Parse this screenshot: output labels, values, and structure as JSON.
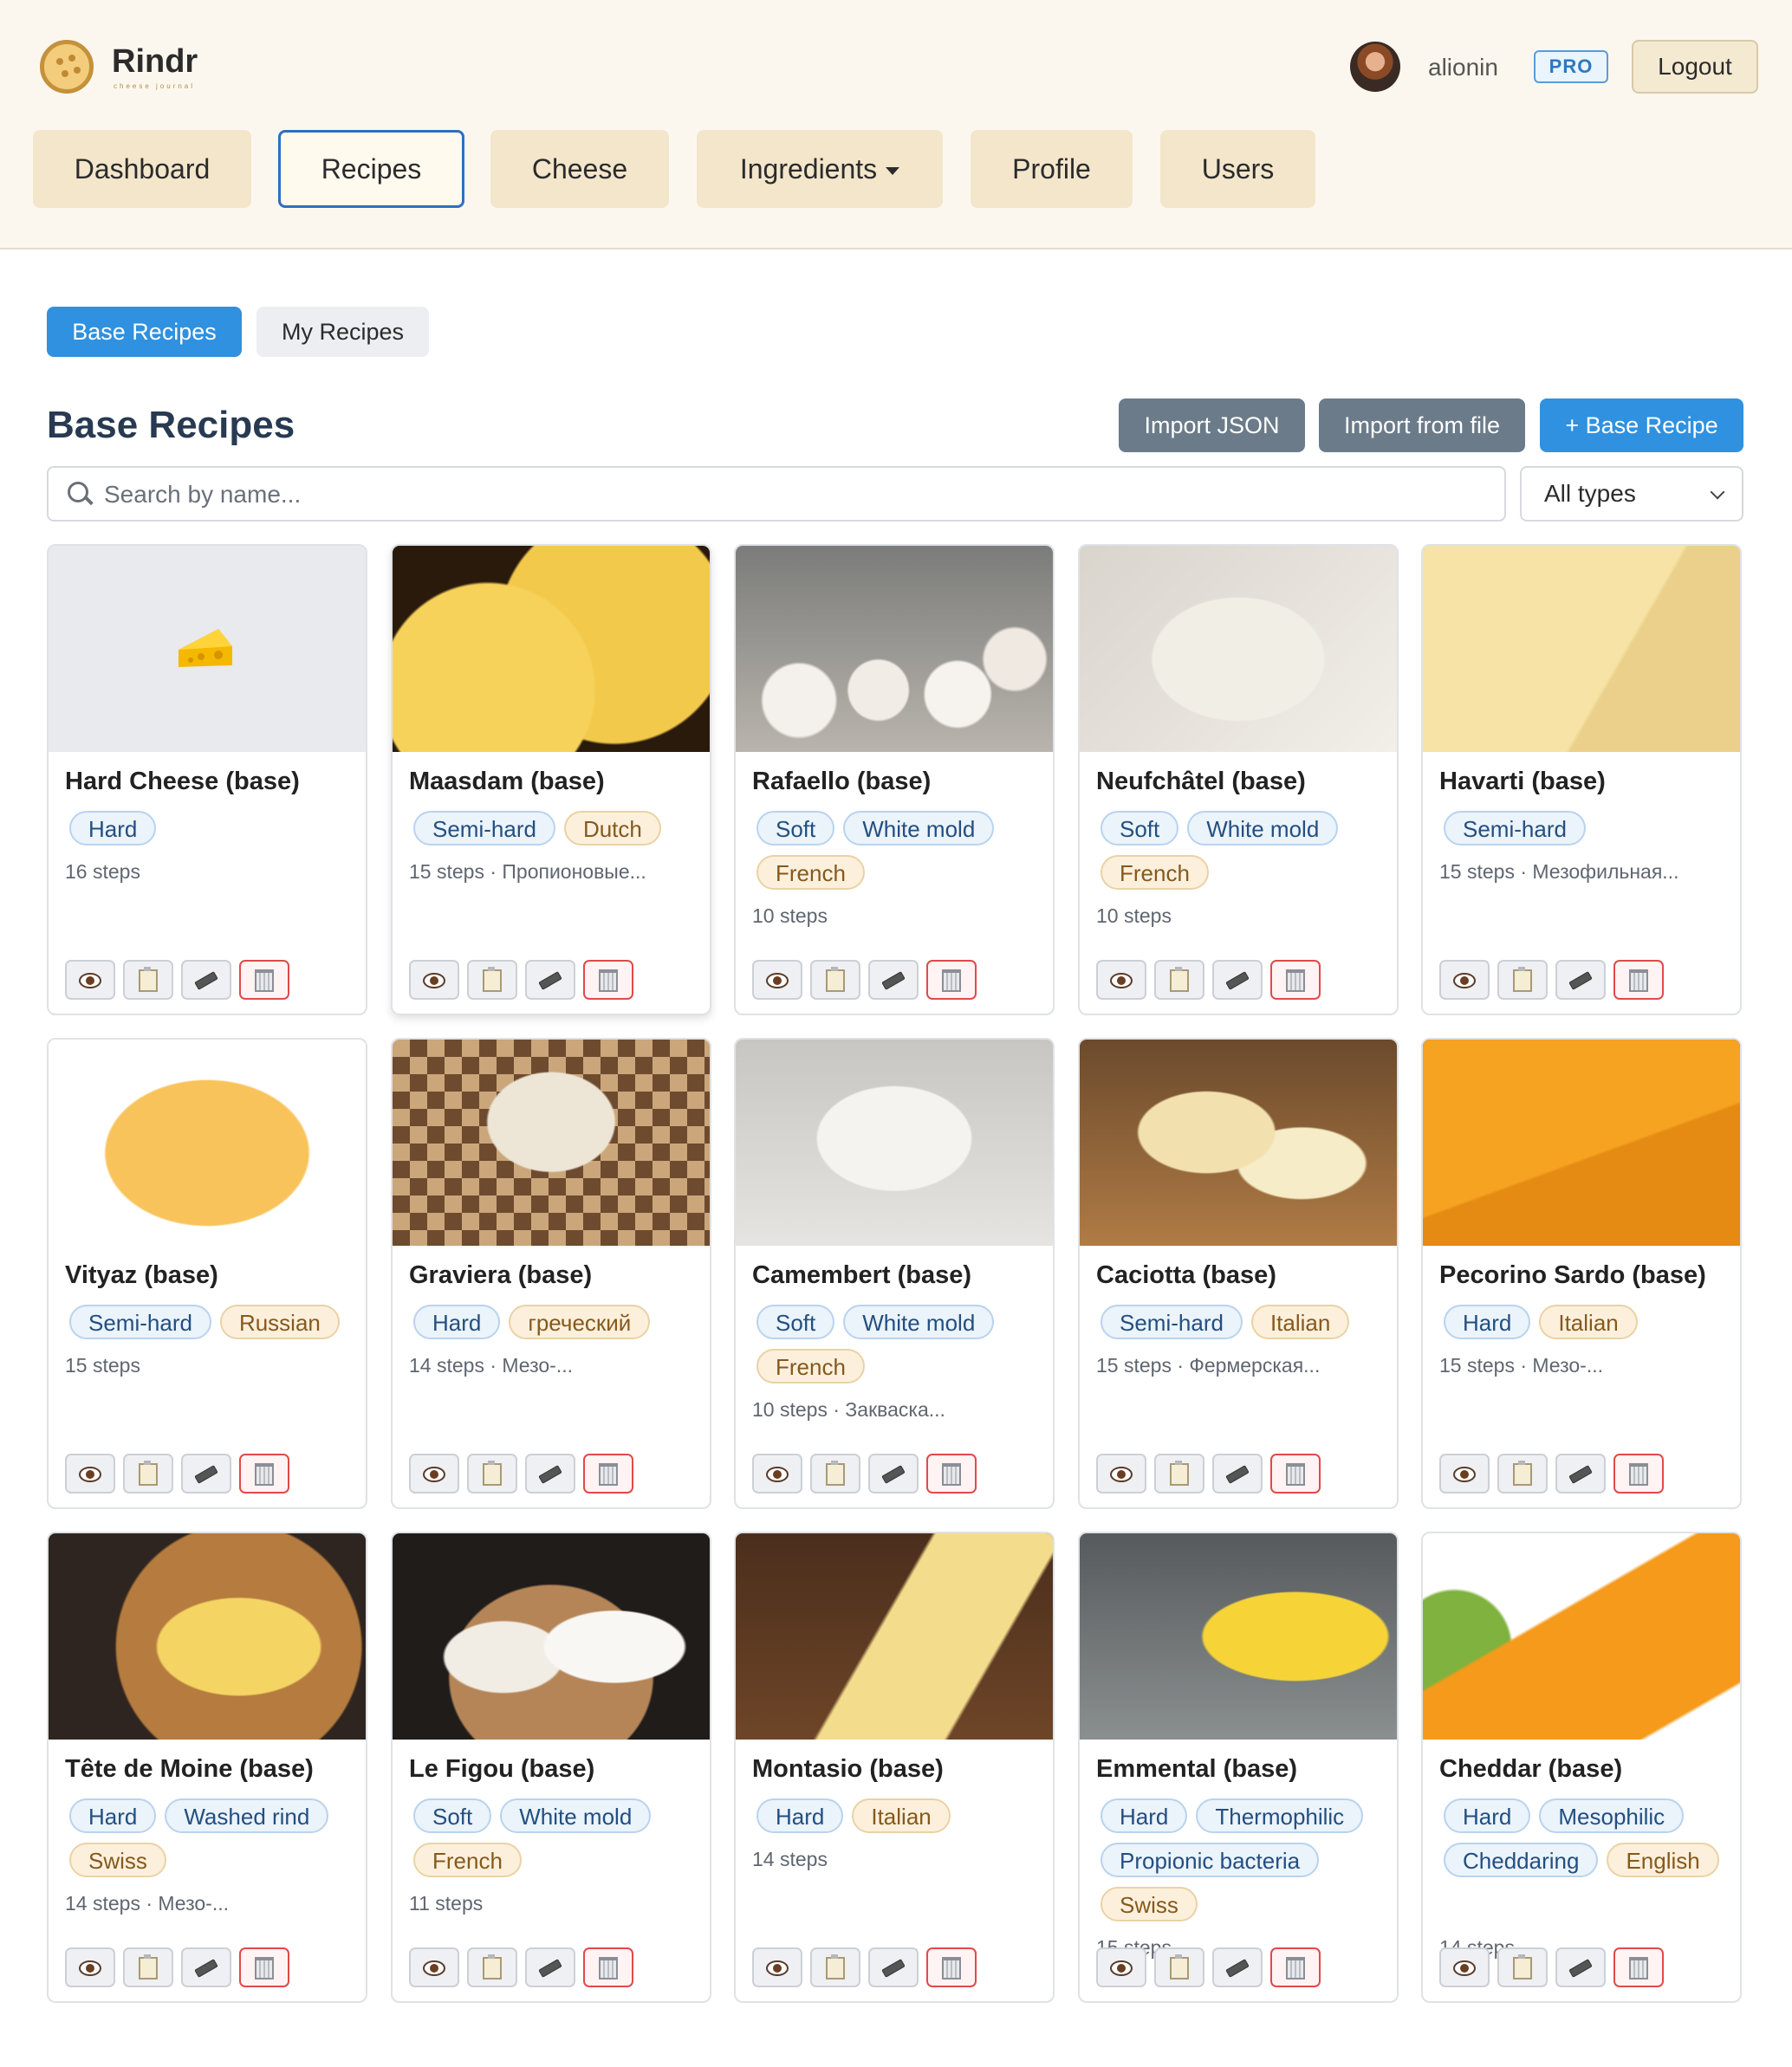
{
  "app": {
    "name": "Rindr",
    "tagline": "cheese journal"
  },
  "user": {
    "name": "alionin",
    "badge": "PRO",
    "logout_label": "Logout"
  },
  "nav": [
    {
      "label": "Dashboard"
    },
    {
      "label": "Recipes",
      "active": true
    },
    {
      "label": "Cheese"
    },
    {
      "label": "Ingredients",
      "dropdown": true
    },
    {
      "label": "Profile"
    },
    {
      "label": "Users"
    }
  ],
  "tabs": [
    {
      "label": "Base Recipes",
      "active": true
    },
    {
      "label": "My Recipes"
    }
  ],
  "page": {
    "title": "Base Recipes",
    "import_json_label": "Import JSON",
    "import_file_label": "Import from file",
    "add_label": "+ Base Recipe",
    "search_placeholder": "Search by name...",
    "type_filter": "All types"
  },
  "colors": {
    "accent_blue": "#2f91df",
    "nav_bg": "#f3e6cb",
    "header_bg": "#fcf7ee",
    "delete_red": "#e04a4a"
  },
  "recipes": [
    {
      "title": "Hard Cheese (base)",
      "tags": [
        [
          "Hard",
          "blue"
        ]
      ],
      "meta": "16 steps",
      "image": "cheese-emoji-placeholder"
    },
    {
      "title": "Maasdam (base)",
      "tags": [
        [
          "Semi-hard",
          "blue"
        ],
        [
          "Dutch",
          "tan"
        ]
      ],
      "meta": "15 steps · Пропионовые...",
      "image": "maasdam-photo"
    },
    {
      "title": "Rafaello (base)",
      "tags": [
        [
          "Soft",
          "blue"
        ],
        [
          "White mold",
          "blue"
        ],
        [
          "French",
          "tan"
        ]
      ],
      "meta": "10 steps",
      "image": "rafaello-photo"
    },
    {
      "title": "Neufchâtel (base)",
      "tags": [
        [
          "Soft",
          "blue"
        ],
        [
          "White mold",
          "blue"
        ],
        [
          "French",
          "tan"
        ]
      ],
      "meta": "10 steps",
      "image": "neufchatel-photo"
    },
    {
      "title": "Havarti (base)",
      "tags": [
        [
          "Semi-hard",
          "blue"
        ]
      ],
      "meta": "15 steps · Мезофильная...",
      "image": "havarti-photo"
    },
    {
      "title": "Vityaz (base)",
      "tags": [
        [
          "Semi-hard",
          "blue"
        ],
        [
          "Russian",
          "tan"
        ]
      ],
      "meta": "15 steps",
      "image": "vityaz-photo"
    },
    {
      "title": "Graviera (base)",
      "tags": [
        [
          "Hard",
          "blue"
        ],
        [
          "греческий",
          "tan"
        ]
      ],
      "meta": "14 steps · Мезо-...",
      "image": "graviera-photo"
    },
    {
      "title": "Camembert (base)",
      "tags": [
        [
          "Soft",
          "blue"
        ],
        [
          "White mold",
          "blue"
        ],
        [
          "French",
          "tan"
        ]
      ],
      "meta": "10 steps · Закваска...",
      "image": "camembert-photo"
    },
    {
      "title": "Caciotta (base)",
      "tags": [
        [
          "Semi-hard",
          "blue"
        ],
        [
          "Italian",
          "tan"
        ]
      ],
      "meta": "15 steps · Фермерская...",
      "image": "caciotta-photo"
    },
    {
      "title": "Pecorino Sardo (base)",
      "tags": [
        [
          "Hard",
          "blue"
        ],
        [
          "Italian",
          "tan"
        ]
      ],
      "meta": "15 steps · Мезо-...",
      "image": "pecorino-photo"
    },
    {
      "title": "Tête de Moine (base)",
      "tags": [
        [
          "Hard",
          "blue"
        ],
        [
          "Washed rind",
          "blue"
        ],
        [
          "Swiss",
          "tan"
        ]
      ],
      "meta": "14 steps · Мезо-...",
      "image": "tete-de-moine-photo"
    },
    {
      "title": "Le Figou (base)",
      "tags": [
        [
          "Soft",
          "blue"
        ],
        [
          "White mold",
          "blue"
        ],
        [
          "French",
          "tan"
        ]
      ],
      "meta": "11 steps",
      "image": "le-figou-photo"
    },
    {
      "title": "Montasio (base)",
      "tags": [
        [
          "Hard",
          "blue"
        ],
        [
          "Italian",
          "tan"
        ]
      ],
      "meta": "14 steps",
      "image": "montasio-photo"
    },
    {
      "title": "Emmental (base)",
      "tags": [
        [
          "Hard",
          "blue"
        ],
        [
          "Thermophilic",
          "blue"
        ],
        [
          "Propionic bacteria",
          "blue"
        ],
        [
          "Swiss",
          "tan"
        ]
      ],
      "meta": "15 steps",
      "image": "emmental-photo"
    },
    {
      "title": "Cheddar (base)",
      "tags": [
        [
          "Hard",
          "blue"
        ],
        [
          "Mesophilic",
          "blue"
        ],
        [
          "Cheddaring",
          "blue"
        ],
        [
          "English",
          "tan"
        ]
      ],
      "meta": "14 steps",
      "image": "cheddar-photo"
    }
  ],
  "card_actions": [
    {
      "name": "view-button",
      "icon": "eye-icon"
    },
    {
      "name": "copy-button",
      "icon": "clipboard-icon"
    },
    {
      "name": "edit-button",
      "icon": "pencil-icon"
    },
    {
      "name": "delete-button",
      "icon": "trash-icon"
    }
  ]
}
